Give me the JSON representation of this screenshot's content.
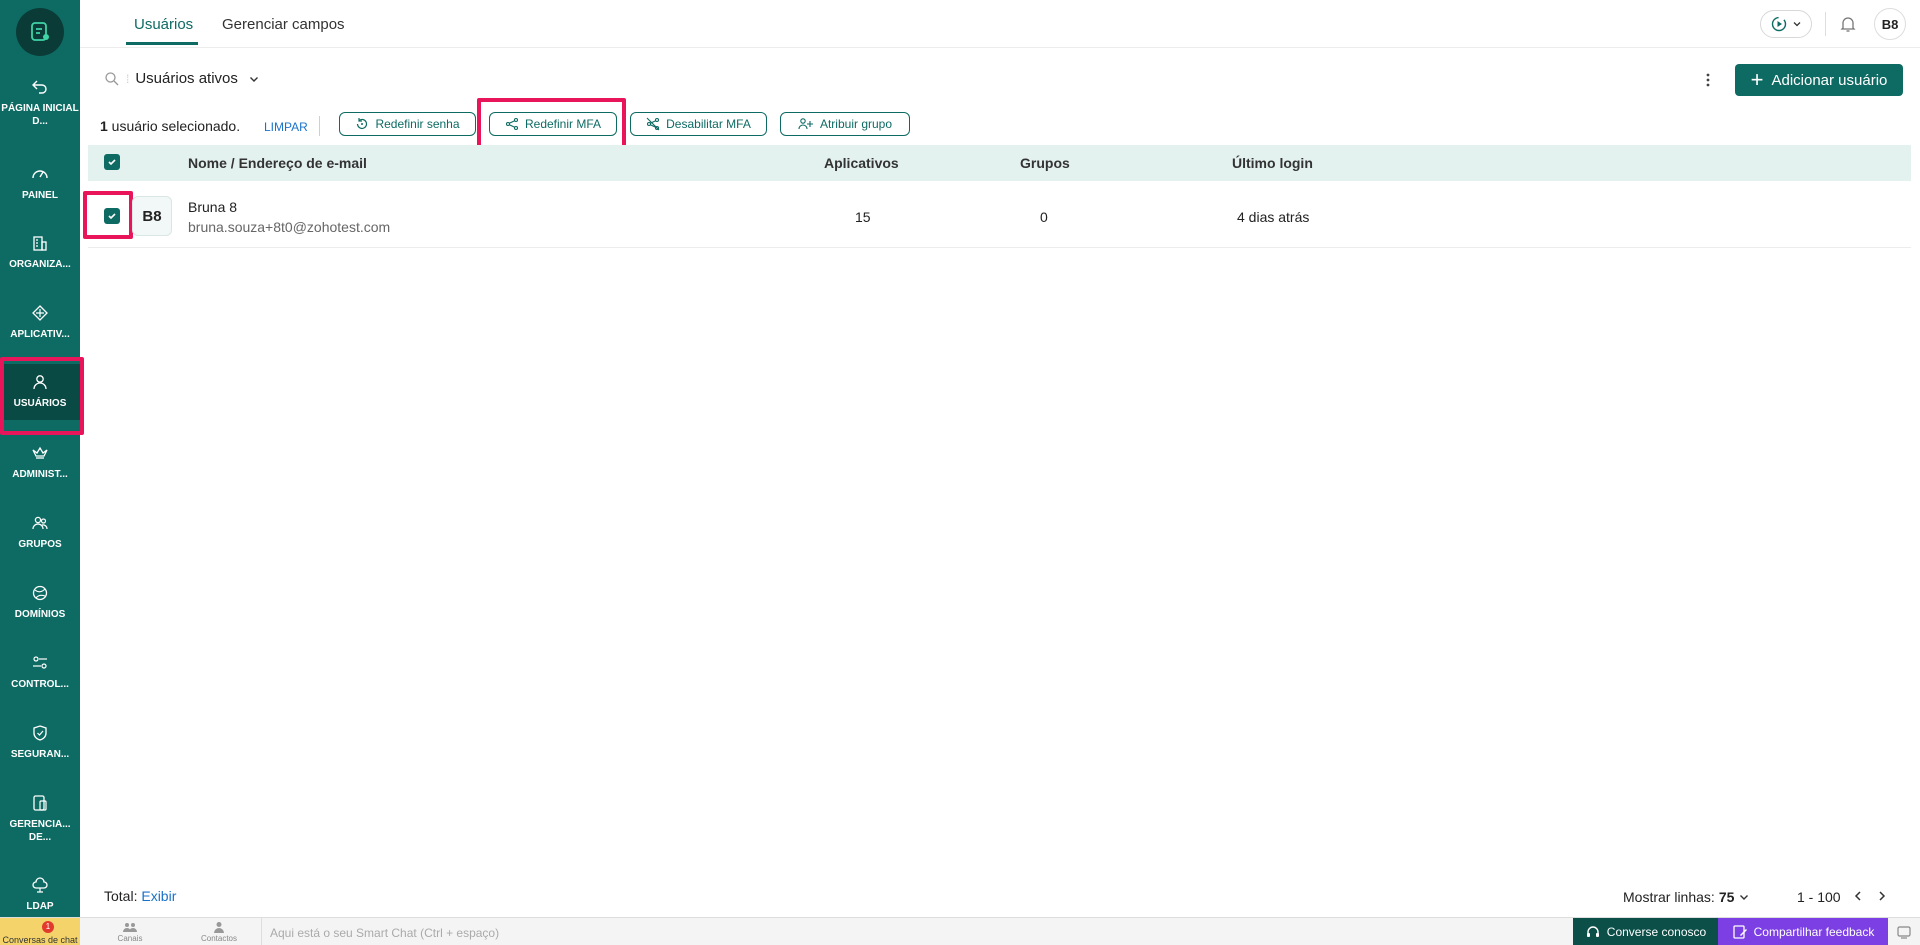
{
  "sidebar": {
    "items": [
      {
        "label": "PÁGINA INICIAL D...",
        "icon": "back-arrow-icon"
      },
      {
        "label": "PAINEL",
        "icon": "gauge-icon"
      },
      {
        "label": "ORGANIZA...",
        "icon": "building-icon"
      },
      {
        "label": "APLICATIV...",
        "icon": "apps-icon"
      },
      {
        "label": "USUÁRIOS",
        "icon": "user-icon"
      },
      {
        "label": "ADMINIST...",
        "icon": "crown-icon"
      },
      {
        "label": "GRUPOS",
        "icon": "group-icon"
      },
      {
        "label": "DOMÍNIOS",
        "icon": "globe-icon"
      },
      {
        "label": "CONTROL...",
        "icon": "controls-icon"
      },
      {
        "label": "SEGURAN...",
        "icon": "shield-icon"
      },
      {
        "label": "GERENCIA... DE...",
        "icon": "device-icon"
      },
      {
        "label": "LDAP",
        "icon": "cloud-icon"
      }
    ]
  },
  "header": {
    "tabs": [
      {
        "label": "Usuários"
      },
      {
        "label": "Gerenciar campos"
      }
    ],
    "avatar": "B8"
  },
  "filter": {
    "label": "Usuários ativos"
  },
  "toolbar": {
    "add_user": "Adicionar usuário"
  },
  "selection": {
    "count": "1",
    "text": " usuário selecionado.",
    "clear": "LIMPAR",
    "actions": [
      {
        "label": "Redefinir senha",
        "icon": "reset-password-icon"
      },
      {
        "label": "Redefinir MFA",
        "icon": "reset-mfa-icon"
      },
      {
        "label": "Desabilitar MFA",
        "icon": "disable-mfa-icon"
      },
      {
        "label": "Atribuir grupo",
        "icon": "assign-group-icon"
      }
    ]
  },
  "table": {
    "columns": [
      "Nome / Endereço de e-mail",
      "Aplicativos",
      "Grupos",
      "Último login"
    ],
    "rows": [
      {
        "initials": "B8",
        "name": "Bruna 8",
        "email": "bruna.souza+8t0@zohotest.com",
        "apps": "15",
        "groups": "0",
        "last_login": "4 dias atrás"
      }
    ]
  },
  "footer": {
    "total_label": "Total:",
    "total_link": "Exibir",
    "rows_label": "Mostrar linhas:",
    "rows_value": "75",
    "range": "1 - 100"
  },
  "chatbar": {
    "conversations": "Conversas de chat",
    "badge": "1",
    "channels": "Canais",
    "contacts": "Contactos",
    "placeholder": "Aqui está o seu Smart Chat (Ctrl + espaço)",
    "talk": "Converse conosco",
    "feedback": "Compartilhar feedback"
  },
  "colors": {
    "primary": "#0e6b63",
    "highlight": "#e8155b",
    "link": "#1a73c9",
    "header_row": "#e3f1ef"
  }
}
